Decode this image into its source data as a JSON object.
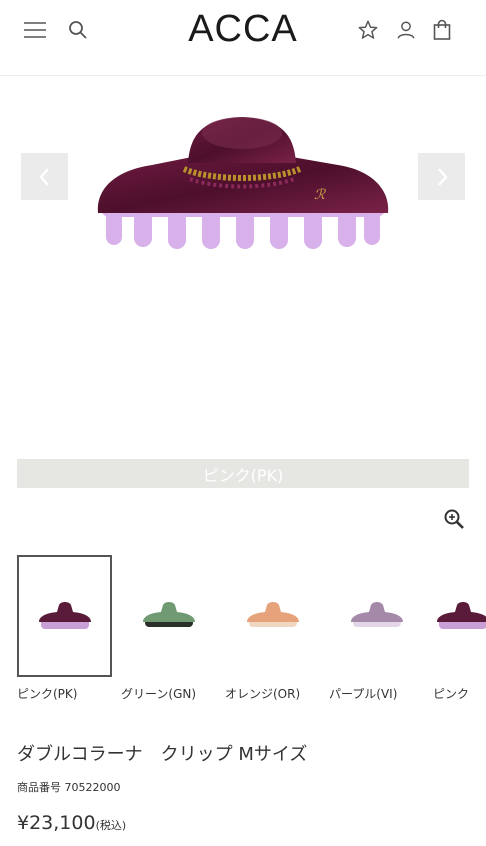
{
  "header": {
    "brand": "ACCA",
    "menu_icon": "hamburger-menu-icon",
    "search_icon": "search-icon",
    "wishlist_icon": "star-icon",
    "account_icon": "user-icon",
    "cart_icon": "shopping-bag-icon"
  },
  "gallery": {
    "prev_icon": "chevron-left-icon",
    "next_icon": "chevron-right-icon",
    "caption": "ピンク(PK)",
    "zoom_icon": "zoom-in-icon"
  },
  "swatches": [
    {
      "label": "ピンク(PK)",
      "top_color": "#5a1a3a",
      "teeth_color": "#c9a0d6",
      "selected": true
    },
    {
      "label": "グリーン(GN)",
      "top_color": "#6f9a72",
      "teeth_color": "#2a2f2a",
      "selected": false
    },
    {
      "label": "オレンジ(OR)",
      "top_color": "#e6a27a",
      "teeth_color": "#f0d7c2",
      "selected": false
    },
    {
      "label": "パープル(VI)",
      "top_color": "#a48aa8",
      "teeth_color": "#e3d6e6",
      "selected": false
    },
    {
      "label": "ピンク",
      "top_color": "#5a1a3a",
      "teeth_color": "#c9a0d6",
      "selected": false
    }
  ],
  "product": {
    "title": "ダブルコラーナ　クリップ Mサイズ",
    "sku": "商品番号 70522000",
    "price": "¥23,100",
    "tax_note": "(税込)"
  },
  "colors": {
    "tortoise_dark": "#5b1335",
    "pink_teeth": "#d7aee8",
    "gold": "#b8902c",
    "caption_bg": "#e6e6e3"
  }
}
